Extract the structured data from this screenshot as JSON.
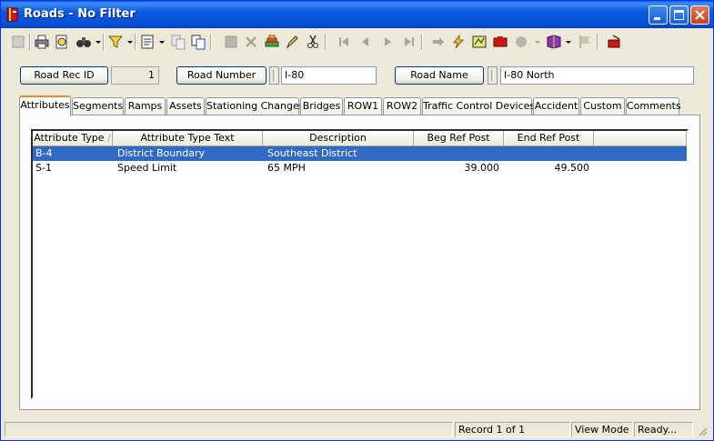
{
  "window": {
    "title": "Roads - No Filter"
  },
  "toolbar": {
    "icons": [
      "new-record",
      "print",
      "print-preview",
      "find",
      "filter",
      "report",
      "copy",
      "paste",
      "save",
      "delete",
      "stamp",
      "edit",
      "cut",
      "first",
      "previous",
      "next",
      "last",
      "goto",
      "refresh",
      "map",
      "highway-sign",
      "link",
      "book",
      "flag",
      "exit"
    ]
  },
  "form": {
    "road_rec_id_label": "Road Rec ID",
    "road_rec_id_value": "1",
    "road_number_label": "Road Number",
    "road_number_value": "I-80",
    "road_name_label": "Road Name",
    "road_name_value": "I-80 North"
  },
  "tabs": [
    "Attributes",
    "Segments",
    "Ramps",
    "Assets",
    "Stationing Changes",
    "Bridges",
    "ROW1",
    "ROW2",
    "Traffic Control Devices",
    "Accident",
    "Custom",
    "Comments"
  ],
  "active_tab": "Attributes",
  "grid": {
    "columns": [
      "Attribute Type",
      "Attribute Type Text",
      "Description",
      "Beg Ref Post",
      "End Ref Post"
    ],
    "sort_indicator": "/",
    "rows": [
      {
        "type": "B-4",
        "type_text": "District Boundary",
        "description": "Southeast District",
        "beg": "",
        "end": "",
        "selected": true
      },
      {
        "type": "S-1",
        "type_text": "Speed Limit",
        "description": "65 MPH",
        "beg": "39.000",
        "end": "49.500",
        "selected": false
      }
    ]
  },
  "status": {
    "record": "Record 1 of 1",
    "mode": "View Mode",
    "state": "Ready..."
  },
  "colors": {
    "titlebar": "#0550d6",
    "selection": "#316ac5",
    "active_tab_accent": "#e68b2c"
  }
}
